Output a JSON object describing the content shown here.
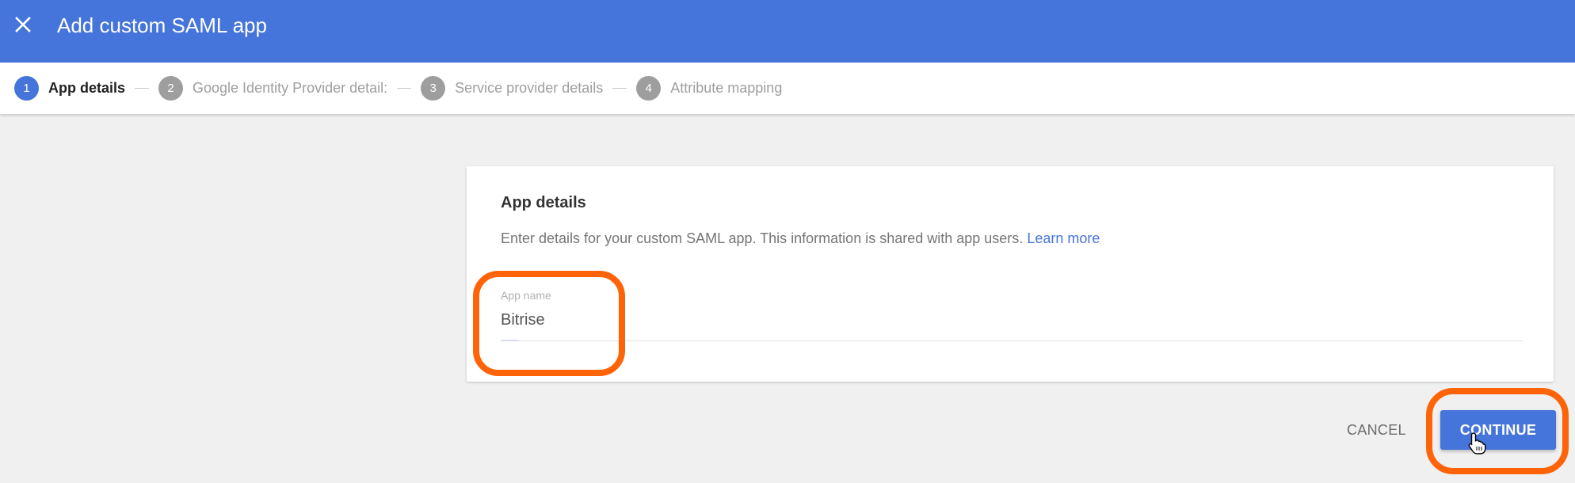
{
  "header": {
    "title": "Add custom SAML app",
    "close_icon": "close-icon",
    "background_color": "#4574db"
  },
  "stepper": {
    "steps": [
      {
        "number": "1",
        "label": "App details",
        "active": true
      },
      {
        "number": "2",
        "label": "Google Identity Provider detail:",
        "active": false
      },
      {
        "number": "3",
        "label": "Service provider details",
        "active": false
      },
      {
        "number": "4",
        "label": "Attribute mapping",
        "active": false
      }
    ]
  },
  "card": {
    "title": "App details",
    "description": "Enter details for your custom SAML app. This information is shared with app users.",
    "learn_more": "Learn more",
    "app_name_field": {
      "label": "App name",
      "value": "Bitrise"
    }
  },
  "actions": {
    "cancel_label": "CANCEL",
    "continue_label": "CONTINUE"
  },
  "annotations": {
    "highlight_color": "#ff6308",
    "cursor_icon": "hand-pointer-icon"
  }
}
